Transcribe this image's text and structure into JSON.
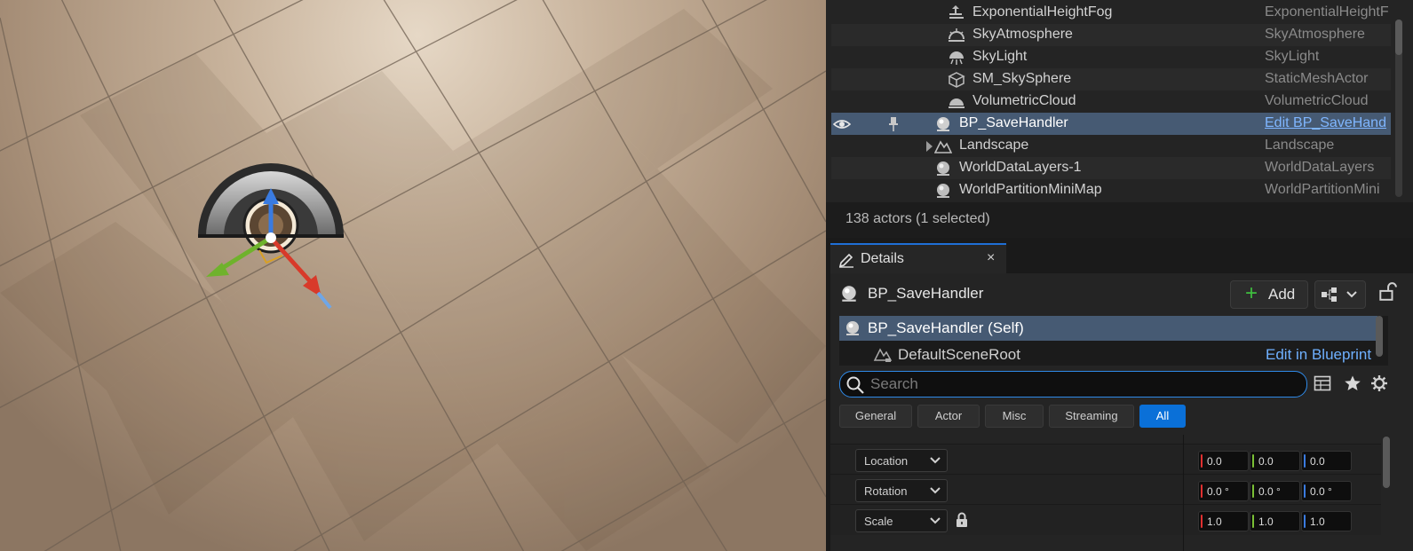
{
  "outliner": {
    "rows": [
      {
        "name": "ExponentialHeightFog",
        "type": "ExponentialHeightF",
        "icon": "fog-icon"
      },
      {
        "name": "SkyAtmosphere",
        "type": "SkyAtmosphere",
        "icon": "sky-atmosphere-icon"
      },
      {
        "name": "SkyLight",
        "type": "SkyLight",
        "icon": "skylight-icon"
      },
      {
        "name": "SM_SkySphere",
        "type": "StaticMeshActor",
        "icon": "static-mesh-icon"
      },
      {
        "name": "VolumetricCloud",
        "type": "VolumetricCloud",
        "icon": "cloud-icon"
      },
      {
        "name": "BP_SaveHandler",
        "type": "Edit BP_SaveHand",
        "icon": "actor-icon",
        "selected": true
      },
      {
        "name": "Landscape",
        "type": "Landscape",
        "icon": "landscape-icon"
      },
      {
        "name": "WorldDataLayers-1",
        "type": "WorldDataLayers",
        "icon": "actor-icon"
      },
      {
        "name": "WorldPartitionMiniMap",
        "type": "WorldPartitionMini",
        "icon": "actor-icon"
      }
    ],
    "status": "138 actors (1 selected)"
  },
  "details": {
    "tab_label": "Details",
    "close_label": "×",
    "actor_name": "BP_SaveHandler",
    "add_label": "Add",
    "components": {
      "self_label": "BP_SaveHandler (Self)",
      "root_label": "DefaultSceneRoot",
      "edit_label": "Edit in Blueprint"
    },
    "search": {
      "placeholder": "Search",
      "value": ""
    },
    "filters": [
      "General",
      "Actor",
      "Misc",
      "Streaming",
      "All"
    ],
    "active_filter": "All",
    "transform": [
      {
        "label": "Location",
        "x": "0.0",
        "y": "0.0",
        "z": "0.0"
      },
      {
        "label": "Rotation",
        "x": "0.0 °",
        "y": "0.0 °",
        "z": "0.0 °"
      },
      {
        "label": "Scale",
        "x": "1.0",
        "y": "1.0",
        "z": "1.0"
      }
    ]
  },
  "colors": {
    "accent": "#0a70d8",
    "selection": "#465a73",
    "axis_x": "#e03030",
    "axis_y": "#7ac035",
    "axis_z": "#3a7be0"
  }
}
